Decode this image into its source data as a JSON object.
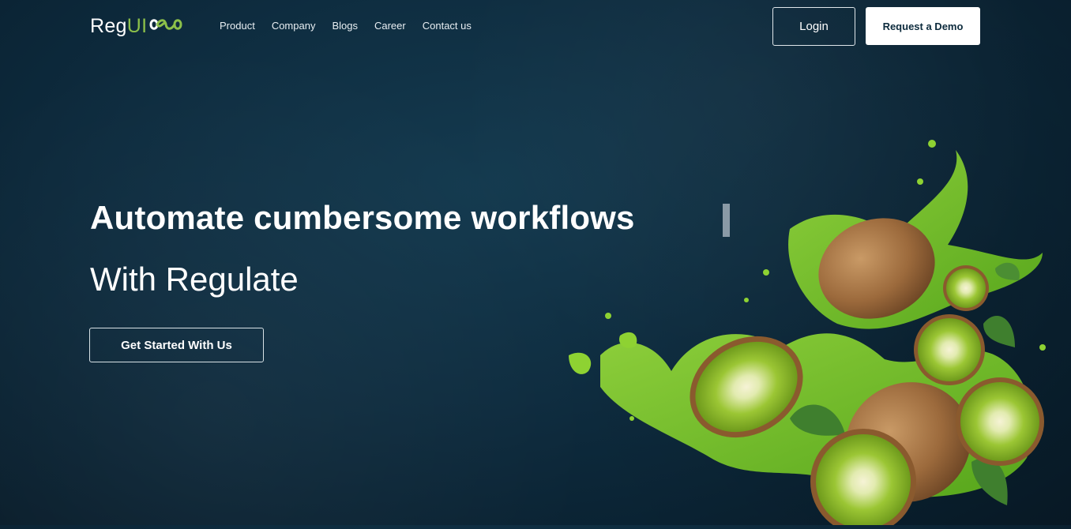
{
  "header": {
    "logo": {
      "text_main": "Reg",
      "text_accent": "UI",
      "mark_icon": "infinity-icon"
    },
    "nav": [
      {
        "label": "Product"
      },
      {
        "label": "Company"
      },
      {
        "label": "Blogs"
      },
      {
        "label": "Career"
      },
      {
        "label": "Contact us"
      }
    ],
    "login_label": "Login",
    "demo_label": "Request a Demo"
  },
  "hero": {
    "headline": "Automate cumbersome workflows",
    "subheadline": "With Regulate",
    "cta_label": "Get Started With Us",
    "image_icon": "kiwi-juice-splash-illustration"
  },
  "colors": {
    "background": "#0e2c3f",
    "accent": "#8cc04a",
    "button_bg": "#ffffff",
    "button_text": "#0d2b3d"
  }
}
